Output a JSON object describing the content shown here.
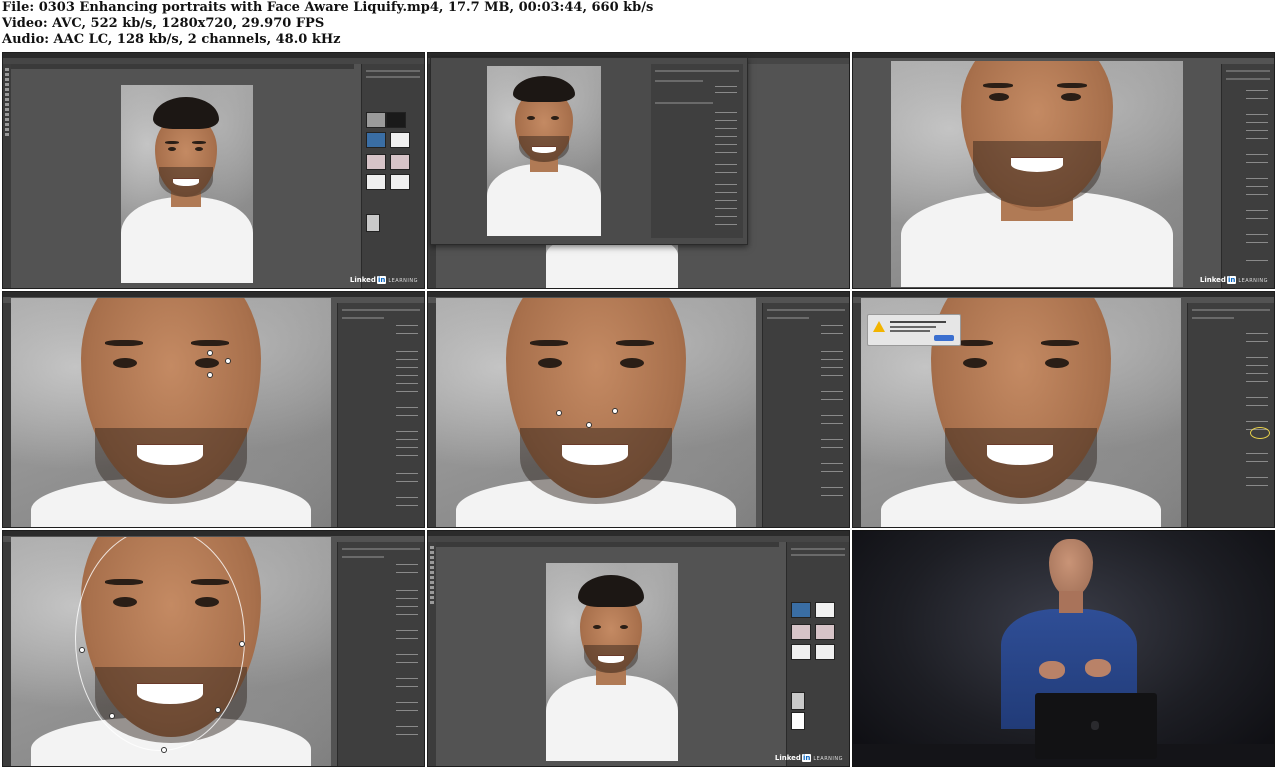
{
  "header": {
    "file_line": "File: 0303 Enhancing portraits with Face Aware Liquify.mp4, 17.7 MB, 00:03:44, 660 kb/s",
    "video_line": "Video: AVC, 522 kb/s, 1280x720, 29.970 FPS",
    "audio_line": "Audio: AAC LC, 128 kb/s, 2 channels, 48.0 kHz"
  },
  "watermark": {
    "brand": "Linked",
    "in": "in",
    "learning": "LEARNING"
  },
  "colors": {
    "ps_ui_dark": "#535353",
    "ps_panel": "#3e3e3e",
    "linkedin_blue": "#0a66c2",
    "alert_warning": "#f2b400",
    "presenter_shirt": "#2f4e96"
  },
  "thumbnails": [
    {
      "scene": "photoshop-workspace-full-portrait"
    },
    {
      "scene": "liquify-dialog-open"
    },
    {
      "scene": "liquify-zoomed-face"
    },
    {
      "scene": "liquify-eye-handles"
    },
    {
      "scene": "liquify-nose-handles"
    },
    {
      "scene": "liquify-alert-dialog"
    },
    {
      "scene": "liquify-face-shape-handles"
    },
    {
      "scene": "photoshop-workspace-result"
    },
    {
      "scene": "presenter-on-stage"
    }
  ]
}
